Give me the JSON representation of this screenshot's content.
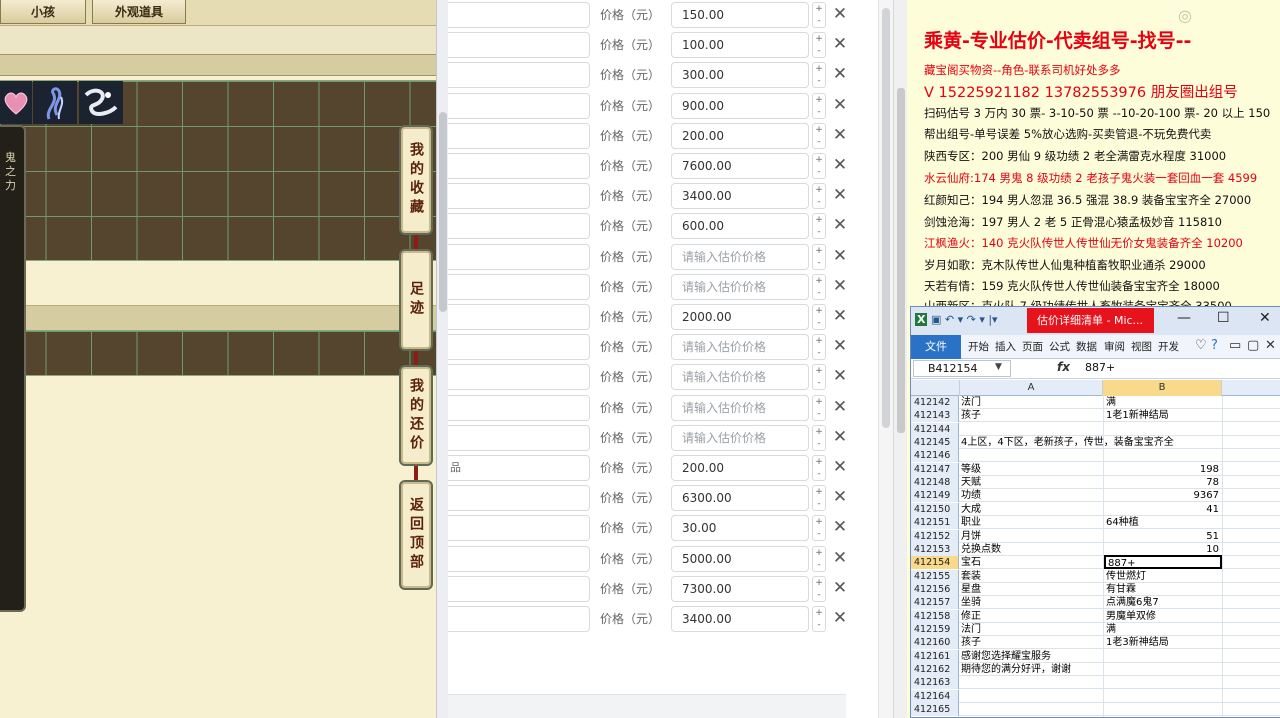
{
  "game": {
    "tabs": [
      "小孩",
      "外观道具"
    ],
    "side_text": "鬼之力",
    "side_buttons": [
      "我的收藏",
      "足迹",
      "我的还价",
      "返回顶部"
    ]
  },
  "form": {
    "row_label": "价格（元）",
    "placeholder": "请输入估价价格",
    "partial_text": "品",
    "rows": [
      {
        "price": "150.00"
      },
      {
        "price": "100.00"
      },
      {
        "price": "300.00"
      },
      {
        "price": "900.00"
      },
      {
        "price": "200.00"
      },
      {
        "price": "7600.00"
      },
      {
        "price": "3400.00"
      },
      {
        "price": "600.00"
      },
      {
        "price": ""
      },
      {
        "price": ""
      },
      {
        "price": "2000.00"
      },
      {
        "price": ""
      },
      {
        "price": ""
      },
      {
        "price": ""
      },
      {
        "price": ""
      },
      {
        "price": "200.00"
      },
      {
        "price": "6300.00"
      },
      {
        "price": "30.00"
      },
      {
        "price": "5000.00"
      },
      {
        "price": "7300.00"
      },
      {
        "price": "3400.00"
      }
    ]
  },
  "notice": {
    "watermark": "",
    "heading": "乘黄-专业估价-代卖组号-找号--",
    "lines": [
      {
        "text": "藏宝阁买物资--角色-联系司机好处多多",
        "red": true,
        "big": false
      },
      {
        "text": "V 15225921182   13782553976 朋友圈出组号",
        "red": true,
        "big": true
      },
      {
        "text": "扫码估号 3 万内 30 票- 3-10-50 票  --10-20-100 票- 20 以上 150",
        "red": false,
        "big": false
      },
      {
        "text": "帮出组号-单号误差 5%放心选购-买卖管退-不玩免费代卖",
        "red": false,
        "big": false
      },
      {
        "text": "陕西专区：200 男仙 9 级功绩 2 老全满雷克水程度 31000",
        "red": false,
        "big": false
      },
      {
        "text": "水云仙府:174 男鬼 8 级功绩 2 老孩子鬼火装一套回血一套 4599",
        "red": true,
        "big": false
      },
      {
        "text": "红颜知己：194 男人忽混 36.5 强混 38.9 装备宝宝齐全 27000",
        "red": false,
        "big": false
      },
      {
        "text": "剑蚀沧海：197 男人 2 老 5 正骨混心猿孟极妙音 115810",
        "red": false,
        "big": false
      },
      {
        "text": "江枫渔火：140 克火队传世人传世仙无价女鬼装备齐全 10200",
        "red": true,
        "big": false
      },
      {
        "text": "岁月如歌：克木队传世人仙鬼种植畜牧职业通杀 29000",
        "red": false,
        "big": false
      },
      {
        "text": "天若有情：159 克火队传世人传世仙装备宝宝齐全 18000",
        "red": false,
        "big": false
      },
      {
        "text": "山西新区：克火队 7 级功绩传世人畜牧装备宝宝齐全 33500",
        "red": false,
        "big": false
      }
    ]
  },
  "excel": {
    "quick_access": "▣ ↶ ▾  ↷ ▾ |▾",
    "title": "估价详细清单 - Mic...",
    "window_controls": [
      "—",
      "☐",
      "✕"
    ],
    "file_tab": "文件",
    "ribbon_tabs": [
      "开始",
      "插入",
      "页面",
      "公式",
      "数据",
      "审阅",
      "视图",
      "开发"
    ],
    "ribbon_icons": [
      "♡",
      "?",
      "▭",
      "▢",
      "✕"
    ],
    "name_box": "B412154",
    "fx": "fx",
    "formula": "887+",
    "columns": [
      "A",
      "B"
    ],
    "rows": [
      {
        "n": "412142",
        "a": "法门",
        "b": "满",
        "num": false
      },
      {
        "n": "412143",
        "a": "孩子",
        "b": "1老1新神结局",
        "num": false
      },
      {
        "n": "412144",
        "a": "",
        "b": "",
        "num": false
      },
      {
        "n": "412145",
        "a": "4上区，4下区，老新孩子，传世，装备宝宝齐全",
        "b": "",
        "num": false
      },
      {
        "n": "412146",
        "a": "",
        "b": "",
        "num": false
      },
      {
        "n": "412147",
        "a": "等级",
        "b": "198",
        "num": true
      },
      {
        "n": "412148",
        "a": "天赋",
        "b": "78",
        "num": true
      },
      {
        "n": "412149",
        "a": "功绩",
        "b": "9367",
        "num": true
      },
      {
        "n": "412150",
        "a": "大成",
        "b": "41",
        "num": true
      },
      {
        "n": "412151",
        "a": "职业",
        "b": "64种植",
        "num": false
      },
      {
        "n": "412152",
        "a": "月饼",
        "b": "51",
        "num": true
      },
      {
        "n": "412153",
        "a": "兑换点数",
        "b": "10",
        "num": true
      },
      {
        "n": "412154",
        "a": "宝石",
        "b": "887+",
        "num": false
      },
      {
        "n": "412155",
        "a": "套装",
        "b": "传世燃灯",
        "num": false
      },
      {
        "n": "412156",
        "a": "星盘",
        "b": "有甘霖",
        "num": false
      },
      {
        "n": "412157",
        "a": "坐骑",
        "b": "点满魔6鬼7",
        "num": false
      },
      {
        "n": "412158",
        "a": "修正",
        "b": "男魔单双修",
        "num": false
      },
      {
        "n": "412159",
        "a": "法门",
        "b": "满",
        "num": false
      },
      {
        "n": "412160",
        "a": "孩子",
        "b": "1老3新神结局",
        "num": false
      },
      {
        "n": "412161",
        "a": "感谢您选择耀宝服务",
        "b": "",
        "num": false
      },
      {
        "n": "412162",
        "a": "期待您的满分好评，谢谢",
        "b": "",
        "num": false
      },
      {
        "n": "412163",
        "a": "",
        "b": "",
        "num": false
      },
      {
        "n": "412164",
        "a": "",
        "b": "",
        "num": false
      },
      {
        "n": "412165",
        "a": "",
        "b": "",
        "num": false
      }
    ],
    "selected_row": "412154"
  }
}
